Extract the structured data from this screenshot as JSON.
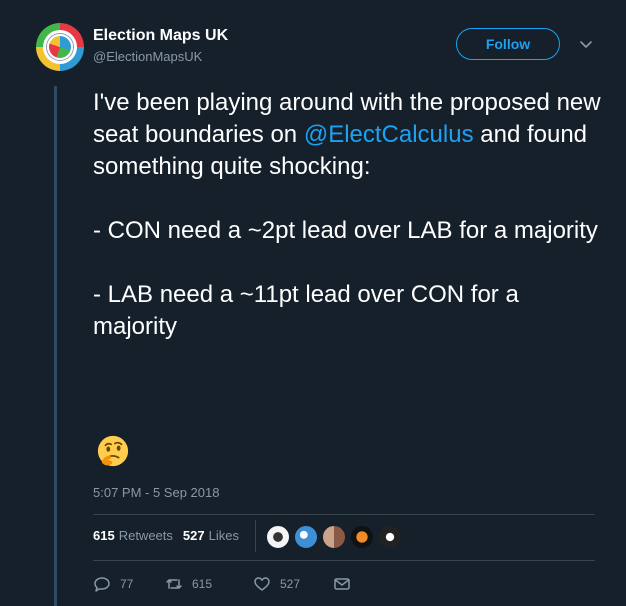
{
  "author": {
    "display_name": "Election Maps UK",
    "handle": "@ElectionMapsUK"
  },
  "header": {
    "follow_label": "Follow"
  },
  "tweet": {
    "text_before_mention": "I've been playing around with the proposed new seat boundaries on ",
    "mention": "@ElectCalculus",
    "text_after_mention": " and found something quite shocking:\n\n- CON need a ~2pt lead over LAB for a majority\n\n- LAB need a ~11pt lead over CON for a majority",
    "emoji_icon": "thinking-face-emoji",
    "timestamp": "5:07 PM - 5 Sep 2018"
  },
  "stats": {
    "retweets_count": "615",
    "retweets_label": "Retweets",
    "likes_count": "527",
    "likes_label": "Likes"
  },
  "likers": [
    {
      "icon": "liker-avatar-1",
      "color": "#f5f5f5"
    },
    {
      "icon": "liker-avatar-2",
      "color": "#3d8fd6"
    },
    {
      "icon": "liker-avatar-3",
      "color": "#c9a48a"
    },
    {
      "icon": "liker-avatar-4",
      "color": "#d9531e"
    },
    {
      "icon": "liker-avatar-5",
      "color": "#222222"
    }
  ],
  "actions": {
    "reply_count": "77",
    "retweet_count": "615",
    "like_count": "527"
  },
  "colors": {
    "background": "#15202b",
    "accent": "#1da1f2",
    "muted_text": "#8899a6"
  }
}
